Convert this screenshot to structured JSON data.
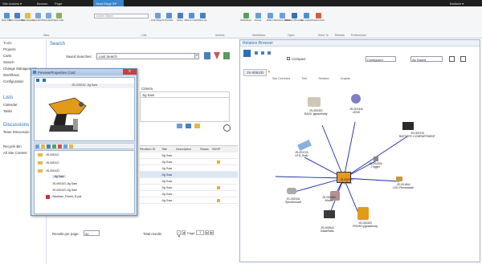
{
  "topbar": {
    "site_actions": "Site Actions ▾",
    "tab_browse": "Browse",
    "tab_page": "Page",
    "tab_send_edge": "Send Edge SP",
    "tab_power": "Power",
    "user": "Baldwin ▾"
  },
  "ribbon": {
    "buttons": [
      "New Part",
      "New Assembly",
      "New Report",
      "New ECO",
      "New ECR",
      "New Cart",
      "Active Object",
      "Link Objects",
      "Transfer",
      "Move",
      "Where Used",
      "Save As",
      "Workflows",
      "Viewer",
      "Editor",
      "Structure Editor",
      "Relation Browser",
      "Get Latest",
      "Preferences"
    ],
    "groups": [
      "New",
      "Link",
      "Actions",
      "Workflows",
      "Open",
      "Send To",
      "Refresh",
      "Preferences"
    ],
    "active_object_placeholder": "Active Object"
  },
  "sidebar": {
    "lists_heading": "Tools",
    "items": [
      "Projects",
      "Carts",
      "Search",
      "Change Management",
      "Workflows",
      "Configuration"
    ],
    "lists_header": "Lists",
    "lists": [
      "Calendar",
      "Tasks"
    ],
    "discussions_header": "Discussions",
    "discussions": [
      "Team Discussion"
    ],
    "bottom": [
      "Recycle Bin",
      "All Site Content"
    ]
  },
  "search": {
    "title": "Search",
    "saved_searches_label": "Saved Searches:",
    "saved_searches_value": "Last Search",
    "criteria_label": "Criteria",
    "criteria_value": "Jig Saw",
    "columns": [
      "Revision ID",
      "Title",
      "Description",
      "Status",
      "SDSP"
    ],
    "rows": [
      {
        "rev": "",
        "title": "Jig Saw",
        "desc": "",
        "status": "",
        "lock": false
      },
      {
        "rev": "",
        "title": "Jig Saw",
        "desc": "",
        "status": "",
        "lock": true
      },
      {
        "rev": "",
        "title": "Jig Saw",
        "desc": "",
        "status": "",
        "lock": false
      },
      {
        "rev": "",
        "title": "Jig Saw",
        "desc": "",
        "status": "",
        "lock": false
      },
      {
        "rev": "",
        "title": "Jig Saw",
        "desc": "",
        "status": "",
        "lock": false
      },
      {
        "rev": "",
        "title": "Jig Saw",
        "desc": "",
        "status": "",
        "lock": true
      },
      {
        "rev": "",
        "title": "Jig Saw",
        "desc": "",
        "status": "",
        "lock": false
      },
      {
        "rev": "",
        "title": "Jig Saw",
        "desc": "",
        "status": "",
        "lock": true
      }
    ],
    "results_per_page_label": "Results per page:",
    "results_per_page": "50",
    "total_results_label": "Total results",
    "page_label": "Page",
    "page_value": "1"
  },
  "popup": {
    "title": "Preview/Properties Card",
    "card_title": "JS-0001/D Jig Saw",
    "close": "✕",
    "tree": [
      {
        "label": "JS-0001/C",
        "indent": 0
      },
      {
        "label": "JS-0001/C",
        "indent": 0
      },
      {
        "label": "JS-0001/D",
        "indent": 0
      },
      {
        "label": "Jig Saw",
        "indent": 1
      },
      {
        "label": "JS-0001/D-Jig Saw",
        "indent": 1
      },
      {
        "label": "JS-0001/D-Jig Saw",
        "indent": 1
      },
      {
        "label": "SawAsm_Finish_D.pdf",
        "indent": 1
      }
    ]
  },
  "relation": {
    "title": "Relation Browser",
    "compact_label": "Compact",
    "configured_label": "Configured",
    "as_saved_label": "As Saved",
    "tab_label": "JS-0001/D",
    "view_tabs": [
      "Site Overview",
      "Tree",
      "Relation",
      "Graphic"
    ],
    "center": "JS-0001/D",
    "nodes": [
      {
        "id": "JS-0003/D",
        "sub": "BACK jigsawbody"
      },
      {
        "id": "JS-0013/A",
        "sub": "LENS"
      },
      {
        "id": "JS-0007/A",
        "sub": "BATTERY COMPARTMENT"
      },
      {
        "id": "JS-0017/A",
        "sub": "LED_Bulb"
      },
      {
        "id": "JS-0015/A",
        "sub": "Trigger"
      },
      {
        "id": "JS-0016/A",
        "sub": "LED-Receptacle"
      },
      {
        "id": "JS-0002/A",
        "sub": "Motor"
      },
      {
        "id": "JS-0023/A",
        "sub": "Spindleshaft"
      },
      {
        "id": "JS-0005/A",
        "sub": "BaseRails"
      },
      {
        "id": "JS-0003/D",
        "sub": "FRONT-jigsawbody"
      },
      {
        "id": "JS-0001/D",
        "sub": "Jig Saw"
      }
    ]
  }
}
